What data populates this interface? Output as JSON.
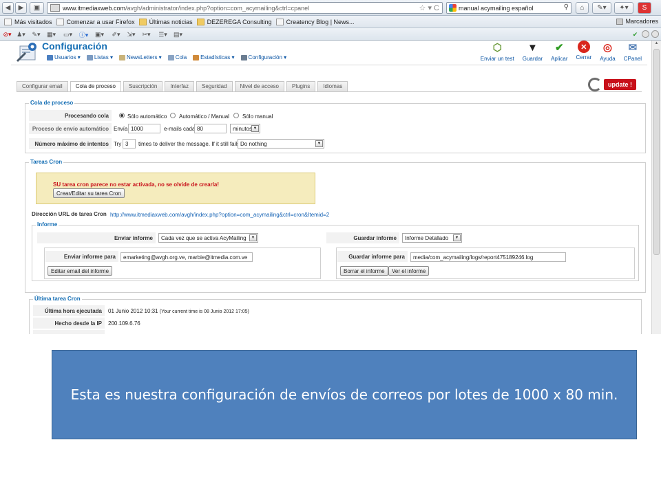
{
  "browser": {
    "url_host": "www.itmediaxweb.com",
    "url_path": "/avgh/administrator/index.php?option=com_acymailing&ctrl=cpanel",
    "search_text": "manual acymailing español",
    "bookmarks": [
      "Más visitados",
      "Comenzar a usar Firefox",
      "Últimas noticias",
      "DEZEREGA Consulting",
      "Creatency Blog | News..."
    ],
    "bookmarks_right": "Marcadores"
  },
  "app": {
    "title": "Configuración",
    "menu": [
      "Usuarios",
      "Listas",
      "NewsLetters",
      "Cola",
      "Estadísticas",
      "Configuración"
    ],
    "actions": [
      "Enviar un test",
      "Guardar",
      "Aplicar",
      "Cerrar",
      "Ayuda",
      "CPanel"
    ]
  },
  "tabs": [
    "Configurar email",
    "Cola de proceso",
    "Suscripción",
    "Interfaz",
    "Seguridad",
    "Nivel de acceso",
    "Plugins",
    "Idiomas"
  ],
  "update_label": "update !",
  "cola": {
    "legend": "Cola de proceso",
    "procesando_label": "Procesando cola",
    "radio_options": [
      "Sólo automático",
      "Automático / Manual",
      "Sólo manual"
    ],
    "envio_label": "Proceso de envío automático",
    "envia": "Envía",
    "batch_value": "1000",
    "emails_cada": "e-mails cada",
    "interval_value": "80",
    "interval_unit": "minutos",
    "max_label": "Número máximo de intentos",
    "try": "Try",
    "max_value": "3",
    "times_text": "times to deliver the message. If it still fails,",
    "fail_action": "Do nothing"
  },
  "cron": {
    "legend": "Tareas Cron",
    "warning": "SU tarea cron parece no estar activada, no se olvide de crearla!",
    "create_button": "Crear/Editar su tarea Cron",
    "url_label": "Dirección URL de tarea Cron",
    "url_value": "http://www.itmediaxweb.com/avgh/index.php?option=com_acymailing&ctrl=cron&Itemid=2"
  },
  "informe": {
    "legend": "Informe",
    "enviar_label": "Enviar informe",
    "enviar_value": "Cada vez que se activa AcyMailing",
    "guardar_label": "Guardar informe",
    "guardar_value": "Informe Detallado",
    "enviar_para_label": "Enviar informe para",
    "enviar_para_value": "emarketing@avgh.org.ve, marbie@itmedia.com.ve",
    "editar_button": "Editar email del informe",
    "guardar_para_label": "Guardar informe para",
    "guardar_para_value": "media/com_acymailing/logs/report475189246.log",
    "borrar_button": "Borrar el informe",
    "ver_button": "Ver el informe"
  },
  "ultima": {
    "legend": "Última tarea Cron",
    "hora_label": "Última hora ejecutada",
    "hora_value": "01 Junio 2012 10:31",
    "hora_note": "(Your current time is 08 Junio 2012 17:05)",
    "ip_label": "Hecho desde la IP",
    "ip_value": "200.109.6.76"
  },
  "caption": "Esta es nuestra configuración de envíos de correos por lotes de 1000 x 80 min.",
  "colors": {
    "accent_blue": "#146eb4",
    "warning_red": "#c8101a",
    "caption_bg": "#4f81bd"
  }
}
